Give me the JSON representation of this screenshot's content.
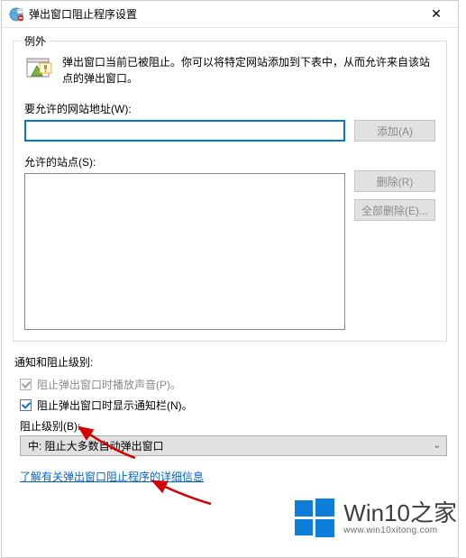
{
  "titlebar": {
    "title": "弹出窗口阻止程序设置"
  },
  "exceptions": {
    "group_title": "例外",
    "info_text": "弹出窗口当前已被阻止。你可以将特定网站添加到下表中，从而允许来自该站点的弹出窗口。",
    "address_label": "要允许的网站地址(W):",
    "address_value": "",
    "add_button": "添加(A)",
    "allowed_label": "允许的站点(S):",
    "remove_button": "删除(R)",
    "remove_all_button": "全部删除(E)..."
  },
  "notification": {
    "section_title": "通知和阻止级别:",
    "sound_checkbox_label": "阻止弹出窗口时播放声音(P)。",
    "notify_checkbox_label": "阻止弹出窗口时显示通知栏(N)。",
    "level_label": "阻止级别(B):",
    "level_value": "中: 阻止大多数自动弹出窗口"
  },
  "link": {
    "text": "了解有关弹出窗口阻止程序的详细信息"
  },
  "watermark": {
    "main": "Win10之家",
    "sub": "www.win10xitong.com"
  }
}
